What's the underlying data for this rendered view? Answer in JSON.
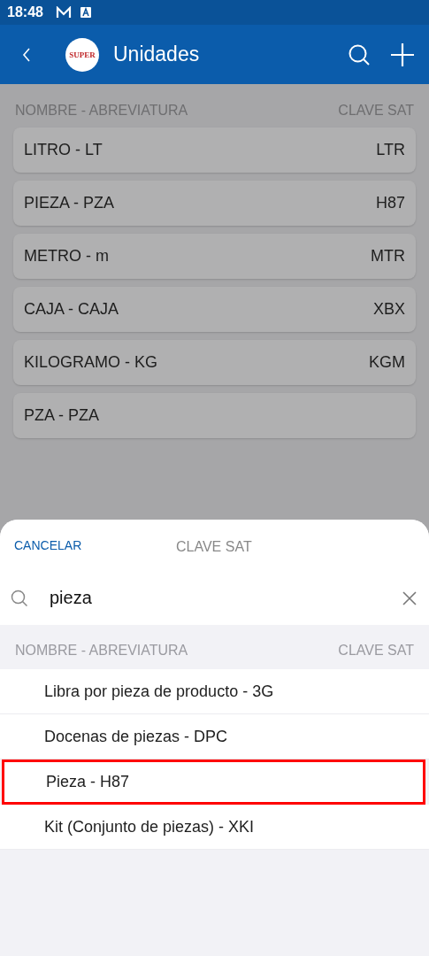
{
  "status_bar": {
    "time": "18:48"
  },
  "app_bar": {
    "logo_text": "SUPER",
    "title": "Unidades"
  },
  "list_header": {
    "name": "NOMBRE - ABREVIATURA",
    "code": "CLAVE SAT"
  },
  "units": [
    {
      "name": "LITRO - LT",
      "code": "LTR"
    },
    {
      "name": "PIEZA - PZA",
      "code": "H87"
    },
    {
      "name": "METRO - m",
      "code": "MTR"
    },
    {
      "name": "CAJA - CAJA",
      "code": "XBX"
    },
    {
      "name": "KILOGRAMO - KG",
      "code": "KGM"
    },
    {
      "name": "PZA - PZA"
    }
  ],
  "sheet": {
    "cancel": "CANCELAR",
    "title": "CLAVE SAT",
    "search_value": "pieza",
    "header": {
      "name": "NOMBRE - ABREVIATURA",
      "code": "CLAVE SAT"
    },
    "results": [
      {
        "label": "Libra por pieza de producto - 3G",
        "selected": false
      },
      {
        "label": "Docenas de piezas - DPC",
        "selected": false
      },
      {
        "label": "Pieza - H87",
        "selected": true
      },
      {
        "label": "Kit (Conjunto de piezas) - XKI",
        "selected": false
      }
    ]
  }
}
